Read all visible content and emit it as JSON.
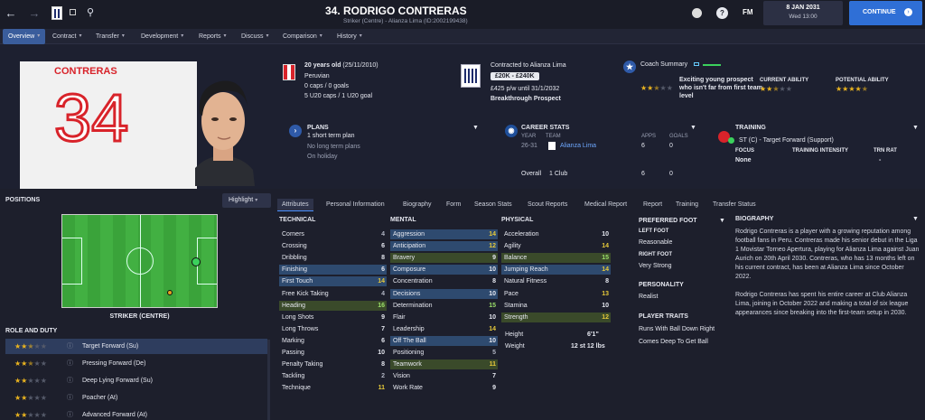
{
  "topbar": {
    "title": "34. RODRIGO CONTRERAS",
    "subtitle": "Striker (Centre) - Alianza Lima (ID:2002199438)",
    "date": "8 JAN 2031",
    "time": "Wed 13:00",
    "continue_label": "CONTINUE",
    "fm_label": "FM",
    "help_label": "?"
  },
  "nav": {
    "items": [
      "Overview",
      "Contract",
      "Transfer",
      "Development",
      "Reports",
      "Discuss",
      "Comparison",
      "History"
    ]
  },
  "player": {
    "shirt_name": "CONTRERAS",
    "shirt_number": "34",
    "age": "20 years old",
    "dob": "(25/11/2010)",
    "nationality": "Peruvian",
    "caps_goals": "0 caps / 0 goals",
    "u20": "5 U20 caps / 1 U20 goal",
    "contract_to": "Contracted to Alianza Lima",
    "value_range": "£20K - £240K",
    "wage": "£425 p/w until 31/1/2032",
    "prospect": "Breakthrough Prospect",
    "coach_summary_label": "Coach Summary",
    "coach_summary_text": "Exciting young prospect who isn't far from first team level",
    "current_ability_label": "CURRENT ABILITY",
    "potential_ability_label": "POTENTIAL ABILITY",
    "coach_stars": 2.5,
    "current_stars": 2.5,
    "potential_stars": 4.5
  },
  "plans": {
    "title": "PLANS",
    "line1": "1 short term plan",
    "line2": "No long term plans",
    "line3": "On holiday"
  },
  "career": {
    "title": "CAREER STATS",
    "year_h": "YEAR",
    "team_h": "TEAM",
    "apps_h": "APPS",
    "goals_h": "GOALS",
    "year": "26-31",
    "team": "Alianza Lima",
    "apps": "6",
    "goals": "0",
    "overall": "Overall",
    "clubs": "1 Club",
    "overall_apps": "6",
    "overall_goals": "0"
  },
  "training": {
    "title": "TRAINING",
    "role": "ST (C) - Target Forward (Support)",
    "focus_h": "FOCUS",
    "intensity_h": "TRAINING INTENSITY",
    "trnrat_h": "TRN RAT",
    "focus": "None",
    "intensity": "",
    "trnrat": "-"
  },
  "positions": {
    "title": "POSITIONS",
    "highlight_label": "Highlight",
    "position_name": "STRIKER (CENTRE)"
  },
  "roles": {
    "title": "ROLE AND DUTY",
    "items": [
      {
        "name": "Target Forward (Su)",
        "stars": 2.5
      },
      {
        "name": "Pressing Forward (De)",
        "stars": 2.5
      },
      {
        "name": "Deep Lying Forward (Su)",
        "stars": 2
      },
      {
        "name": "Poacher (At)",
        "stars": 2
      },
      {
        "name": "Advanced Forward (At)",
        "stars": 2
      }
    ]
  },
  "tabs": [
    "Attributes",
    "Personal Information",
    "Biography",
    "Form",
    "Season Stats",
    "Scout Reports",
    "Medical Report",
    "Report",
    "Training",
    "Transfer Status"
  ],
  "attributes": {
    "technical_title": "TECHNICAL",
    "mental_title": "MENTAL",
    "physical_title": "PHYSICAL",
    "technical": [
      {
        "name": "Corners",
        "value": "4",
        "hl": ""
      },
      {
        "name": "Crossing",
        "value": "6",
        "hl": ""
      },
      {
        "name": "Dribbling",
        "value": "8",
        "hl": ""
      },
      {
        "name": "Finishing",
        "value": "6",
        "hl": "b"
      },
      {
        "name": "First Touch",
        "value": "14",
        "hl": "b"
      },
      {
        "name": "Free Kick Taking",
        "value": "4",
        "hl": ""
      },
      {
        "name": "Heading",
        "value": "16",
        "hl": "g"
      },
      {
        "name": "Long Shots",
        "value": "9",
        "hl": ""
      },
      {
        "name": "Long Throws",
        "value": "7",
        "hl": ""
      },
      {
        "name": "Marking",
        "value": "6",
        "hl": ""
      },
      {
        "name": "Passing",
        "value": "10",
        "hl": ""
      },
      {
        "name": "Penalty Taking",
        "value": "8",
        "hl": ""
      },
      {
        "name": "Tackling",
        "value": "2",
        "hl": ""
      },
      {
        "name": "Technique",
        "value": "11",
        "hl": ""
      }
    ],
    "mental": [
      {
        "name": "Aggression",
        "value": "14",
        "hl": "b"
      },
      {
        "name": "Anticipation",
        "value": "12",
        "hl": "b"
      },
      {
        "name": "Bravery",
        "value": "9",
        "hl": "g"
      },
      {
        "name": "Composure",
        "value": "10",
        "hl": "b"
      },
      {
        "name": "Concentration",
        "value": "8",
        "hl": ""
      },
      {
        "name": "Decisions",
        "value": "10",
        "hl": "b"
      },
      {
        "name": "Determination",
        "value": "15",
        "hl": ""
      },
      {
        "name": "Flair",
        "value": "10",
        "hl": ""
      },
      {
        "name": "Leadership",
        "value": "14",
        "hl": ""
      },
      {
        "name": "Off The Ball",
        "value": "10",
        "hl": "b"
      },
      {
        "name": "Positioning",
        "value": "5",
        "hl": ""
      },
      {
        "name": "Teamwork",
        "value": "11",
        "hl": "g"
      },
      {
        "name": "Vision",
        "value": "7",
        "hl": ""
      },
      {
        "name": "Work Rate",
        "value": "9",
        "hl": ""
      }
    ],
    "physical": [
      {
        "name": "Acceleration",
        "value": "10",
        "hl": ""
      },
      {
        "name": "Agility",
        "value": "14",
        "hl": ""
      },
      {
        "name": "Balance",
        "value": "15",
        "hl": "g"
      },
      {
        "name": "Jumping Reach",
        "value": "14",
        "hl": "b"
      },
      {
        "name": "Natural Fitness",
        "value": "8",
        "hl": ""
      },
      {
        "name": "Pace",
        "value": "13",
        "hl": ""
      },
      {
        "name": "Stamina",
        "value": "10",
        "hl": ""
      },
      {
        "name": "Strength",
        "value": "12",
        "hl": "g"
      }
    ],
    "height_label": "Height",
    "height": "6'1\"",
    "weight_label": "Weight",
    "weight": "12 st 12 lbs"
  },
  "foot": {
    "title": "PREFERRED FOOT",
    "left_label": "LEFT FOOT",
    "left": "Reasonable",
    "right_label": "RIGHT FOOT",
    "right": "Very Strong",
    "personality_label": "PERSONALITY",
    "personality": "Realist",
    "traits_label": "PLAYER TRAITS",
    "trait1": "Runs With Ball Down Right",
    "trait2": "Comes Deep To Get Ball"
  },
  "biography": {
    "title": "BIOGRAPHY",
    "p1": "Rodrigo Contreras is a player with a growing reputation among football fans in Peru. Contreras made his senior debut in the Liga 1 Movistar Torneo Apertura, playing for Alianza Lima against Juan Aurich on 20th April 2030. Contreras, who has 13 months left on his current contract, has been at Alianza Lima since October 2022.",
    "p2": "Rodrigo Contreras has spent his entire career at Club Alianza Lima, joining in October 2022 and making a total of six league appearances since breaking into the first-team setup in 2030."
  },
  "colors": {
    "accent": "#2f6fd6",
    "star": "#e9b31f",
    "shirt_red": "#d8232a"
  }
}
